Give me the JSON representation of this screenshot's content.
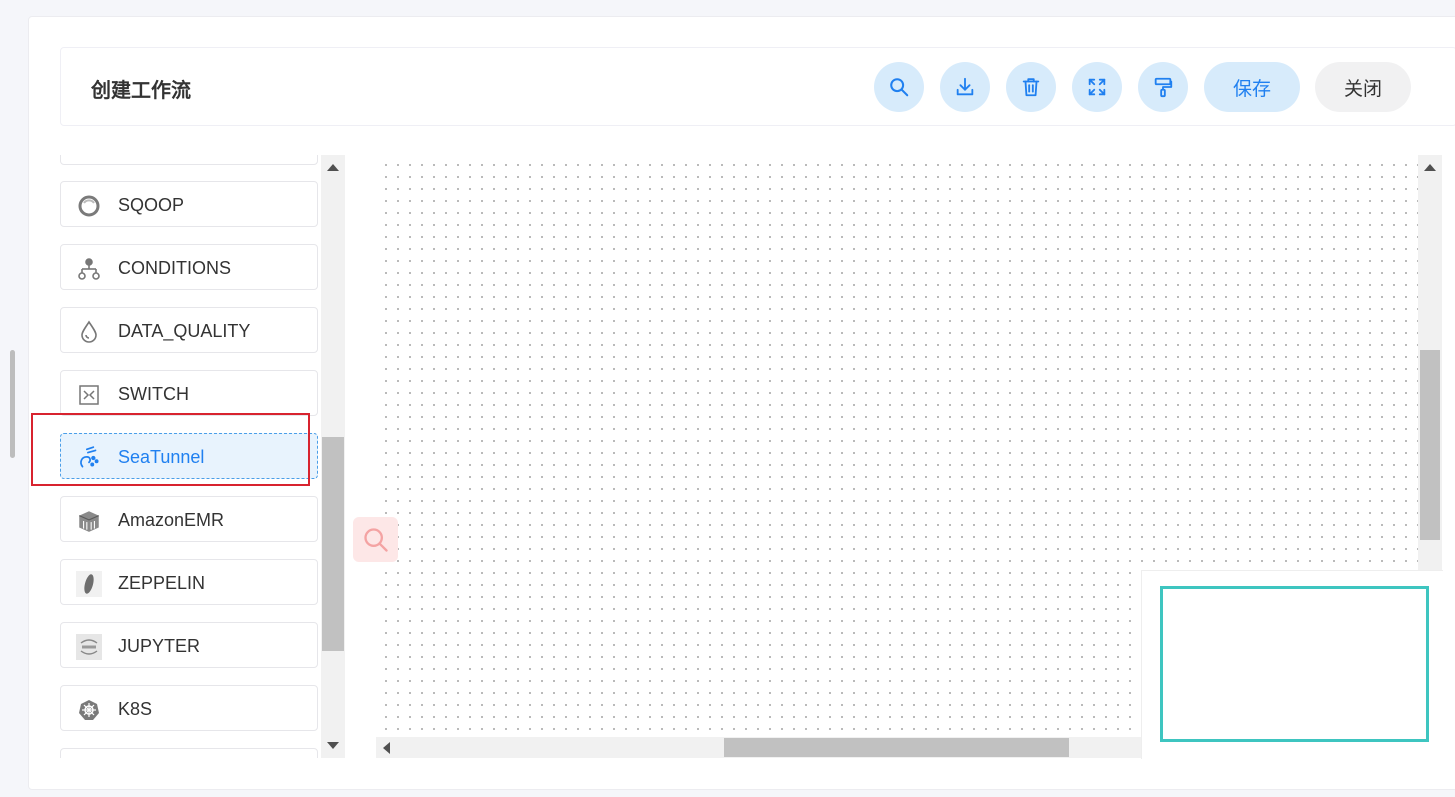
{
  "header": {
    "title": "创建工作流",
    "toolbar": [
      {
        "name": "search-button",
        "icon": "search-icon"
      },
      {
        "name": "download-button",
        "icon": "download-icon"
      },
      {
        "name": "delete-button",
        "icon": "trash-icon"
      },
      {
        "name": "fullscreen-button",
        "icon": "fullscreen-icon"
      },
      {
        "name": "format-button",
        "icon": "paint-roller-icon"
      }
    ],
    "save_label": "保存",
    "close_label": "关闭"
  },
  "sidebar": {
    "items": [
      {
        "label": "SQOOP",
        "icon": "sqoop-icon"
      },
      {
        "label": "CONDITIONS",
        "icon": "conditions-icon"
      },
      {
        "label": "DATA_QUALITY",
        "icon": "data-quality-icon"
      },
      {
        "label": "SWITCH",
        "icon": "switch-icon"
      },
      {
        "label": "SeaTunnel",
        "icon": "seatunnel-icon",
        "active": true
      },
      {
        "label": "AmazonEMR",
        "icon": "amazon-emr-icon"
      },
      {
        "label": "ZEPPELIN",
        "icon": "zeppelin-icon"
      },
      {
        "label": "JUPYTER",
        "icon": "jupyter-icon"
      },
      {
        "label": "K8S",
        "icon": "k8s-icon"
      }
    ]
  },
  "colors": {
    "accent": "#2080f0",
    "button_bg": "#d7ebfb",
    "highlight_border": "#d8232f",
    "minimap_viewport": "#3ec5c0"
  }
}
